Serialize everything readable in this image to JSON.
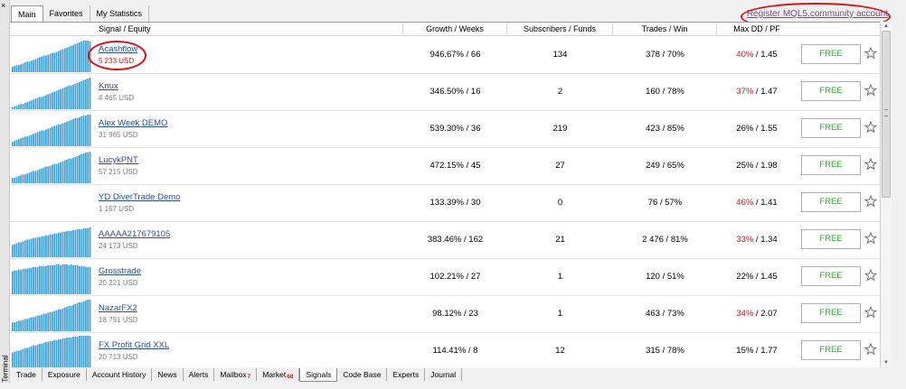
{
  "window": {
    "side_label": "Terminal",
    "close_glyph": "×"
  },
  "top_tabs": [
    {
      "label": "Main",
      "active": true
    },
    {
      "label": "Favorites",
      "active": false
    },
    {
      "label": "My Statistics",
      "active": false
    }
  ],
  "register_link": "Register MQL5.community account",
  "columns": {
    "signal": "Signal / Equity",
    "growth": "Growth / Weeks",
    "subscribers": "Subscribers / Funds",
    "trades": "Trades / Win",
    "maxdd": "Max DD / PF"
  },
  "rows": [
    {
      "name": "Acashflow",
      "equity": "5 233 USD",
      "equity_red": true,
      "growth": "946.67% / 66",
      "subs": "134",
      "trades": "378 / 70%",
      "dd": "40%",
      "pf": " / 1.45",
      "dd_red": true,
      "button": "FREE",
      "spark": [
        6,
        7,
        8,
        8,
        9,
        10,
        11,
        12,
        12,
        13,
        14,
        15,
        16,
        17,
        18,
        19,
        19,
        20,
        21,
        22,
        22,
        23,
        24,
        25,
        26,
        27,
        28,
        29,
        30,
        31,
        32,
        33,
        34,
        35,
        36,
        36,
        36,
        35
      ]
    },
    {
      "name": "Knux",
      "equity": "4 465 USD",
      "equity_red": false,
      "growth": "346.50% / 16",
      "subs": "2",
      "trades": "160 / 78%",
      "dd": "37%",
      "pf": " / 1.47",
      "dd_red": true,
      "button": "FREE",
      "spark": [
        2,
        3,
        4,
        5,
        6,
        6,
        7,
        8,
        9,
        10,
        11,
        12,
        13,
        14,
        14,
        15,
        16,
        17,
        18,
        19,
        20,
        21,
        22,
        23,
        24,
        25,
        26,
        27,
        27,
        28,
        29,
        30,
        31,
        32,
        33,
        34,
        35,
        36
      ]
    },
    {
      "name": "Alex Week DEMO",
      "equity": "31 965 USD",
      "equity_red": false,
      "growth": "539.30% / 36",
      "subs": "219",
      "trades": "423 / 85%",
      "dd": "26%",
      "pf": " / 1.55",
      "dd_red": false,
      "button": "FREE",
      "spark": [
        5,
        6,
        7,
        8,
        9,
        10,
        11,
        11,
        12,
        13,
        14,
        15,
        16,
        17,
        18,
        18,
        19,
        20,
        21,
        22,
        23,
        24,
        25,
        25,
        26,
        27,
        28,
        29,
        30,
        31,
        32,
        32,
        33,
        34,
        35,
        35,
        36,
        36
      ]
    },
    {
      "name": "LucykPNT",
      "equity": "57 215 USD",
      "equity_red": false,
      "growth": "472.15% / 45",
      "subs": "27",
      "trades": "249 / 65%",
      "dd": "25%",
      "pf": " / 1.98",
      "dd_red": false,
      "button": "FREE",
      "spark": [
        6,
        6,
        7,
        8,
        9,
        10,
        10,
        11,
        12,
        13,
        14,
        14,
        15,
        16,
        17,
        18,
        19,
        19,
        20,
        21,
        22,
        22,
        23,
        24,
        25,
        26,
        27,
        28,
        28,
        29,
        30,
        31,
        32,
        33,
        34,
        35,
        35,
        36
      ]
    },
    {
      "name": "YD DiverTrade Demo",
      "equity": "1 167 USD",
      "equity_red": false,
      "growth": "133.39% / 30",
      "subs": "0",
      "trades": "76 / 57%",
      "dd": "46%",
      "pf": " / 1.41",
      "dd_red": true,
      "button": "FREE",
      "spark": []
    },
    {
      "name": "AAAAA217679105",
      "equity": "24 173 USD",
      "equity_red": false,
      "growth": "383.46% / 162",
      "subs": "21",
      "trades": "2 476 / 81%",
      "dd": "33%",
      "pf": " / 1.34",
      "dd_red": true,
      "button": "FREE",
      "spark": [
        14,
        15,
        16,
        17,
        17,
        18,
        19,
        20,
        20,
        21,
        22,
        22,
        23,
        23,
        24,
        24,
        25,
        25,
        26,
        26,
        27,
        27,
        28,
        28,
        29,
        29,
        30,
        30,
        30,
        31,
        31,
        32,
        32,
        32,
        33,
        33,
        33,
        34
      ]
    },
    {
      "name": "Grosstrade",
      "equity": "20 221 USD",
      "equity_red": false,
      "growth": "102.21% / 27",
      "subs": "1",
      "trades": "120 / 51%",
      "dd": "22%",
      "pf": " / 1.45",
      "dd_red": false,
      "button": "FREE",
      "spark": [
        26,
        27,
        27,
        28,
        28,
        29,
        29,
        29,
        30,
        30,
        31,
        31,
        31,
        32,
        32,
        32,
        32,
        33,
        33,
        33,
        33,
        34,
        34,
        33,
        34,
        34,
        34,
        33,
        34,
        33,
        33,
        33,
        32,
        32,
        32,
        31,
        31,
        31
      ]
    },
    {
      "name": "NazarFX2",
      "equity": "18 791 USD",
      "equity_red": false,
      "growth": "98.12% / 23",
      "subs": "1",
      "trades": "463 / 73%",
      "dd": "34%",
      "pf": " / 2.07",
      "dd_red": true,
      "button": "FREE",
      "spark": [
        10,
        10,
        11,
        12,
        12,
        13,
        14,
        14,
        15,
        16,
        16,
        17,
        18,
        18,
        19,
        20,
        20,
        21,
        22,
        22,
        23,
        24,
        25,
        25,
        26,
        27,
        28,
        29,
        29,
        30,
        31,
        32,
        33,
        33,
        34,
        35,
        36,
        36
      ]
    },
    {
      "name": "FX Profit Grid XXL",
      "equity": "20 713 USD",
      "equity_red": false,
      "growth": "114.41% / 8",
      "subs": "12",
      "trades": "315 / 78%",
      "dd": "15%",
      "pf": " / 1.77",
      "dd_red": false,
      "button": "FREE",
      "spark": [
        18,
        19,
        20,
        20,
        21,
        22,
        23,
        23,
        24,
        25,
        26,
        26,
        27,
        28,
        28,
        29,
        30,
        30,
        31,
        31,
        32,
        32,
        33,
        33,
        34,
        34,
        35,
        35,
        35,
        36,
        36,
        36,
        37,
        37,
        37,
        37,
        37,
        37
      ]
    }
  ],
  "bottom_tabs": [
    {
      "label": "Trade",
      "badge": ""
    },
    {
      "label": "Exposure",
      "badge": ""
    },
    {
      "label": "Account History",
      "badge": ""
    },
    {
      "label": "News",
      "badge": ""
    },
    {
      "label": "Alerts",
      "badge": ""
    },
    {
      "label": "Mailbox",
      "badge": "7"
    },
    {
      "label": "Market",
      "badge": "68"
    },
    {
      "label": "Signals",
      "badge": "",
      "active": true
    },
    {
      "label": "Code Base",
      "badge": ""
    },
    {
      "label": "Experts",
      "badge": ""
    },
    {
      "label": "Journal",
      "badge": ""
    }
  ],
  "colors": {
    "spark": "#3a9fd8",
    "link": "#2a4ea8",
    "free": "#2eaa2e",
    "red": "#d8141a"
  },
  "icons": {
    "favorite": "star-icon",
    "close": "close-icon"
  }
}
